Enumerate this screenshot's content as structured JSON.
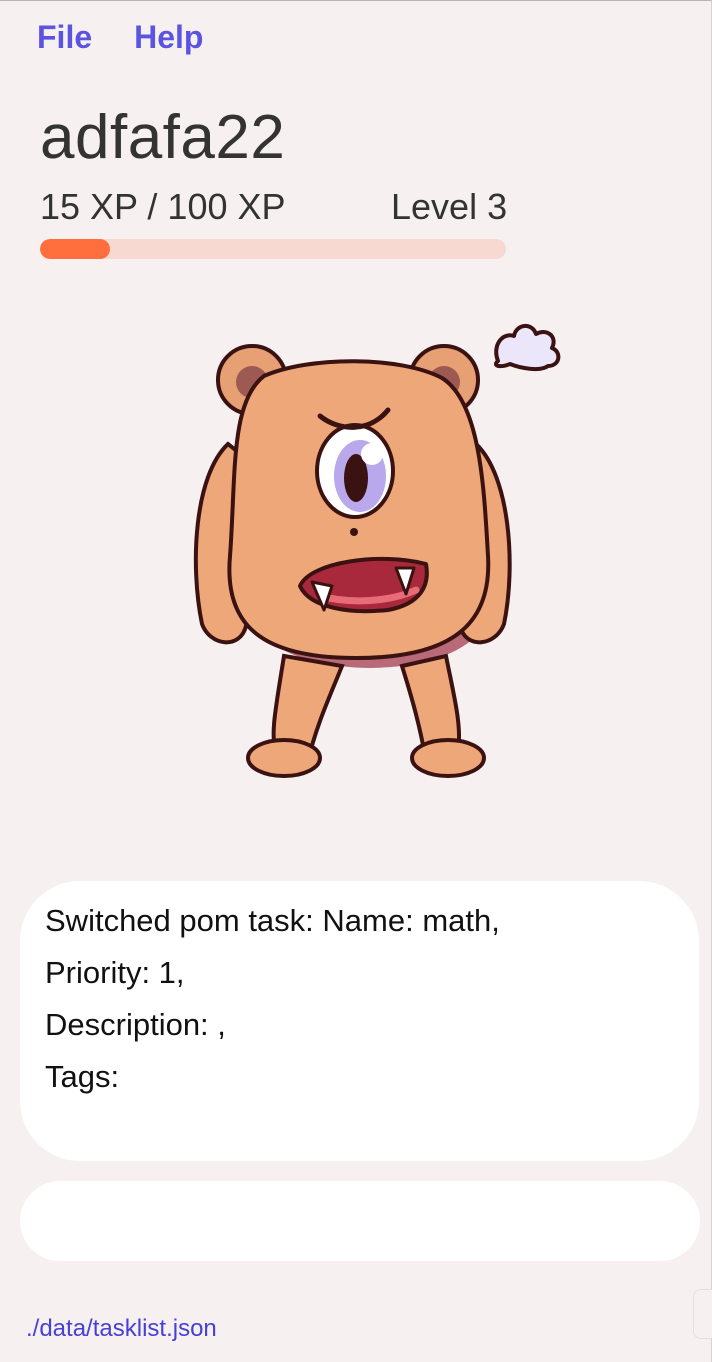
{
  "menu": {
    "file_label": "File",
    "help_label": "Help"
  },
  "profile": {
    "username": "adfafa22",
    "xp_text": "15 XP / 100 XP",
    "level_text": "Level 3",
    "xp_progress": 0.15,
    "progress_color": "#ff6e3c",
    "progress_track_color": "#f7d9d1"
  },
  "mascot": {
    "icon": "angry-one-eyed-bear-monster"
  },
  "result": {
    "lines": [
      "Switched pom task: Name: math,",
      "Priority: 1,",
      "Description: ,",
      "Tags:"
    ]
  },
  "command_box": {
    "value": "",
    "placeholder": ""
  },
  "status_bar": {
    "path": "./data/tasklist.json"
  },
  "colors": {
    "background": "#f6f1f0",
    "accent": "#5b54e0",
    "path_text": "#4740d6"
  }
}
